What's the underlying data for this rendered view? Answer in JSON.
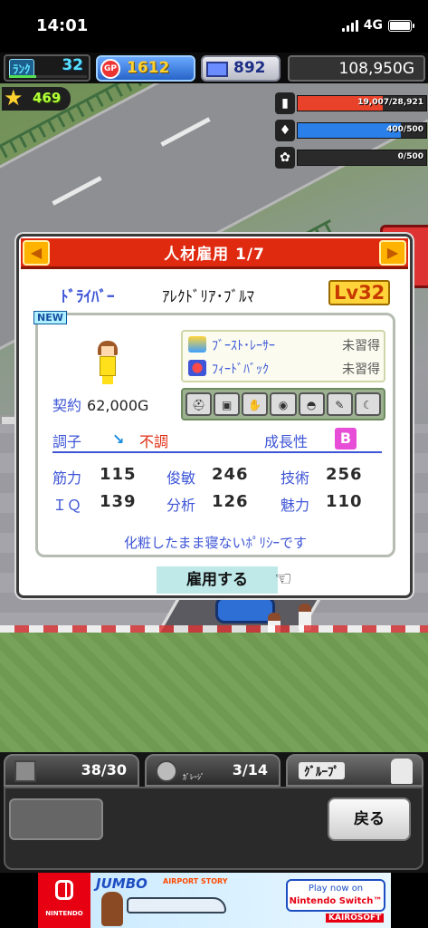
{
  "status_bar": {
    "time": "14:01",
    "network": "4G"
  },
  "hud": {
    "rank_label": "ﾗﾝｸ",
    "rank_value": "32",
    "rank_progress": 0.35,
    "gp_icon": "GP",
    "gp_value": "1612",
    "pc_value": "892",
    "money": "108,950G",
    "star_value": "469",
    "resources": [
      {
        "name": "fuel-icon",
        "text": "19,007/28,921",
        "fraction": 0.66,
        "color": "#e8422a"
      },
      {
        "name": "oil-icon",
        "text": "400/500",
        "fraction": 0.8,
        "color": "#2a7fe8"
      },
      {
        "name": "wheat-icon",
        "text": "0/500",
        "fraction": 0.0,
        "color": "#e8c82a"
      }
    ]
  },
  "dialog": {
    "title": "人材雇用 1/7",
    "role": "ﾄﾞﾗｲﾊﾞｰ",
    "name": "ｱﾚｸﾄﾞﾘｱ･ﾌﾞﾙﾏ",
    "level": "Lv32",
    "new_tag": "NEW",
    "contract_label": "契約",
    "contract_value": "62,000G",
    "skills": [
      {
        "name": "ﾌﾞｰｽﾄ･ﾚｰｻｰ",
        "status": "未習得"
      },
      {
        "name": "ﾌｨｰﾄﾞﾊﾞｯｸ",
        "status": "未習得"
      }
    ],
    "equipment_icons": [
      "helmet-icon",
      "suit-icon",
      "glove-icon",
      "shoes-icon",
      "cap-icon",
      "wrench-icon",
      "moon-icon"
    ],
    "condition_label": "調子",
    "condition_value": "不調",
    "growth_label": "成長性",
    "growth_grade": "B",
    "stats": [
      {
        "label": "筋力",
        "value": "115"
      },
      {
        "label": "俊敏",
        "value": "246"
      },
      {
        "label": "技術",
        "value": "256"
      },
      {
        "label": "ＩＱ",
        "value": "139"
      },
      {
        "label": "分析",
        "value": "126"
      },
      {
        "label": "魅力",
        "value": "110"
      }
    ],
    "quote": "化粧したまま寝ないﾎﾟﾘｼｰです",
    "hire_button": "雇用する"
  },
  "bottom": {
    "tab1_value": "38/30",
    "tab2_value": "3/14",
    "tab2_label": "ｶﾞﾚｰｼﾞ",
    "group_label": "ｸﾞﾙｰﾌﾟ",
    "back_button": "戻る"
  },
  "ad": {
    "brand": "NINTENDO SWITCH",
    "game_title": "JUMBO",
    "game_subtitle": "AIRPORT STORY",
    "cta_line1": "Play now on",
    "cta_line2": "Nintendo Switch™",
    "publisher": "KAIROSOFT"
  }
}
